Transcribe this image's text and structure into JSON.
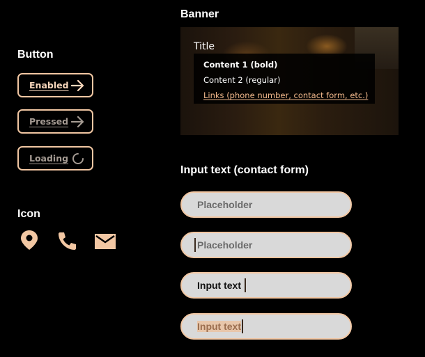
{
  "sections": {
    "button_title": "Button",
    "icon_title": "Icon",
    "banner_title": "Banner",
    "input_title": "Input text (contact form)"
  },
  "buttons": [
    {
      "label": "Enabled",
      "state": "enabled",
      "icon": "arrow-right-icon"
    },
    {
      "label": "Pressed",
      "state": "pressed",
      "icon": "arrow-right-icon"
    },
    {
      "label": "Loading",
      "state": "loading",
      "icon": "spinner-icon"
    }
  ],
  "icons": [
    "location-pin-icon",
    "phone-icon",
    "mail-icon"
  ],
  "banner": {
    "title": "Title",
    "content_bold": "Content 1 (bold)",
    "content_regular": "Content 2 (regular)",
    "links": "Links (phone number, contact form, etc.)"
  },
  "inputs": [
    {
      "state": "placeholder",
      "text": "Placeholder"
    },
    {
      "state": "focused-empty",
      "text": "Placeholder"
    },
    {
      "state": "typing",
      "text": "Input text"
    },
    {
      "state": "selected",
      "text": "Input text"
    }
  ],
  "colors": {
    "accent": "#f2c7a3",
    "accent_text": "#f7d6bb",
    "disabled_text": "#a49a92",
    "field_bg": "#d9d9d9",
    "background": "#000000"
  }
}
